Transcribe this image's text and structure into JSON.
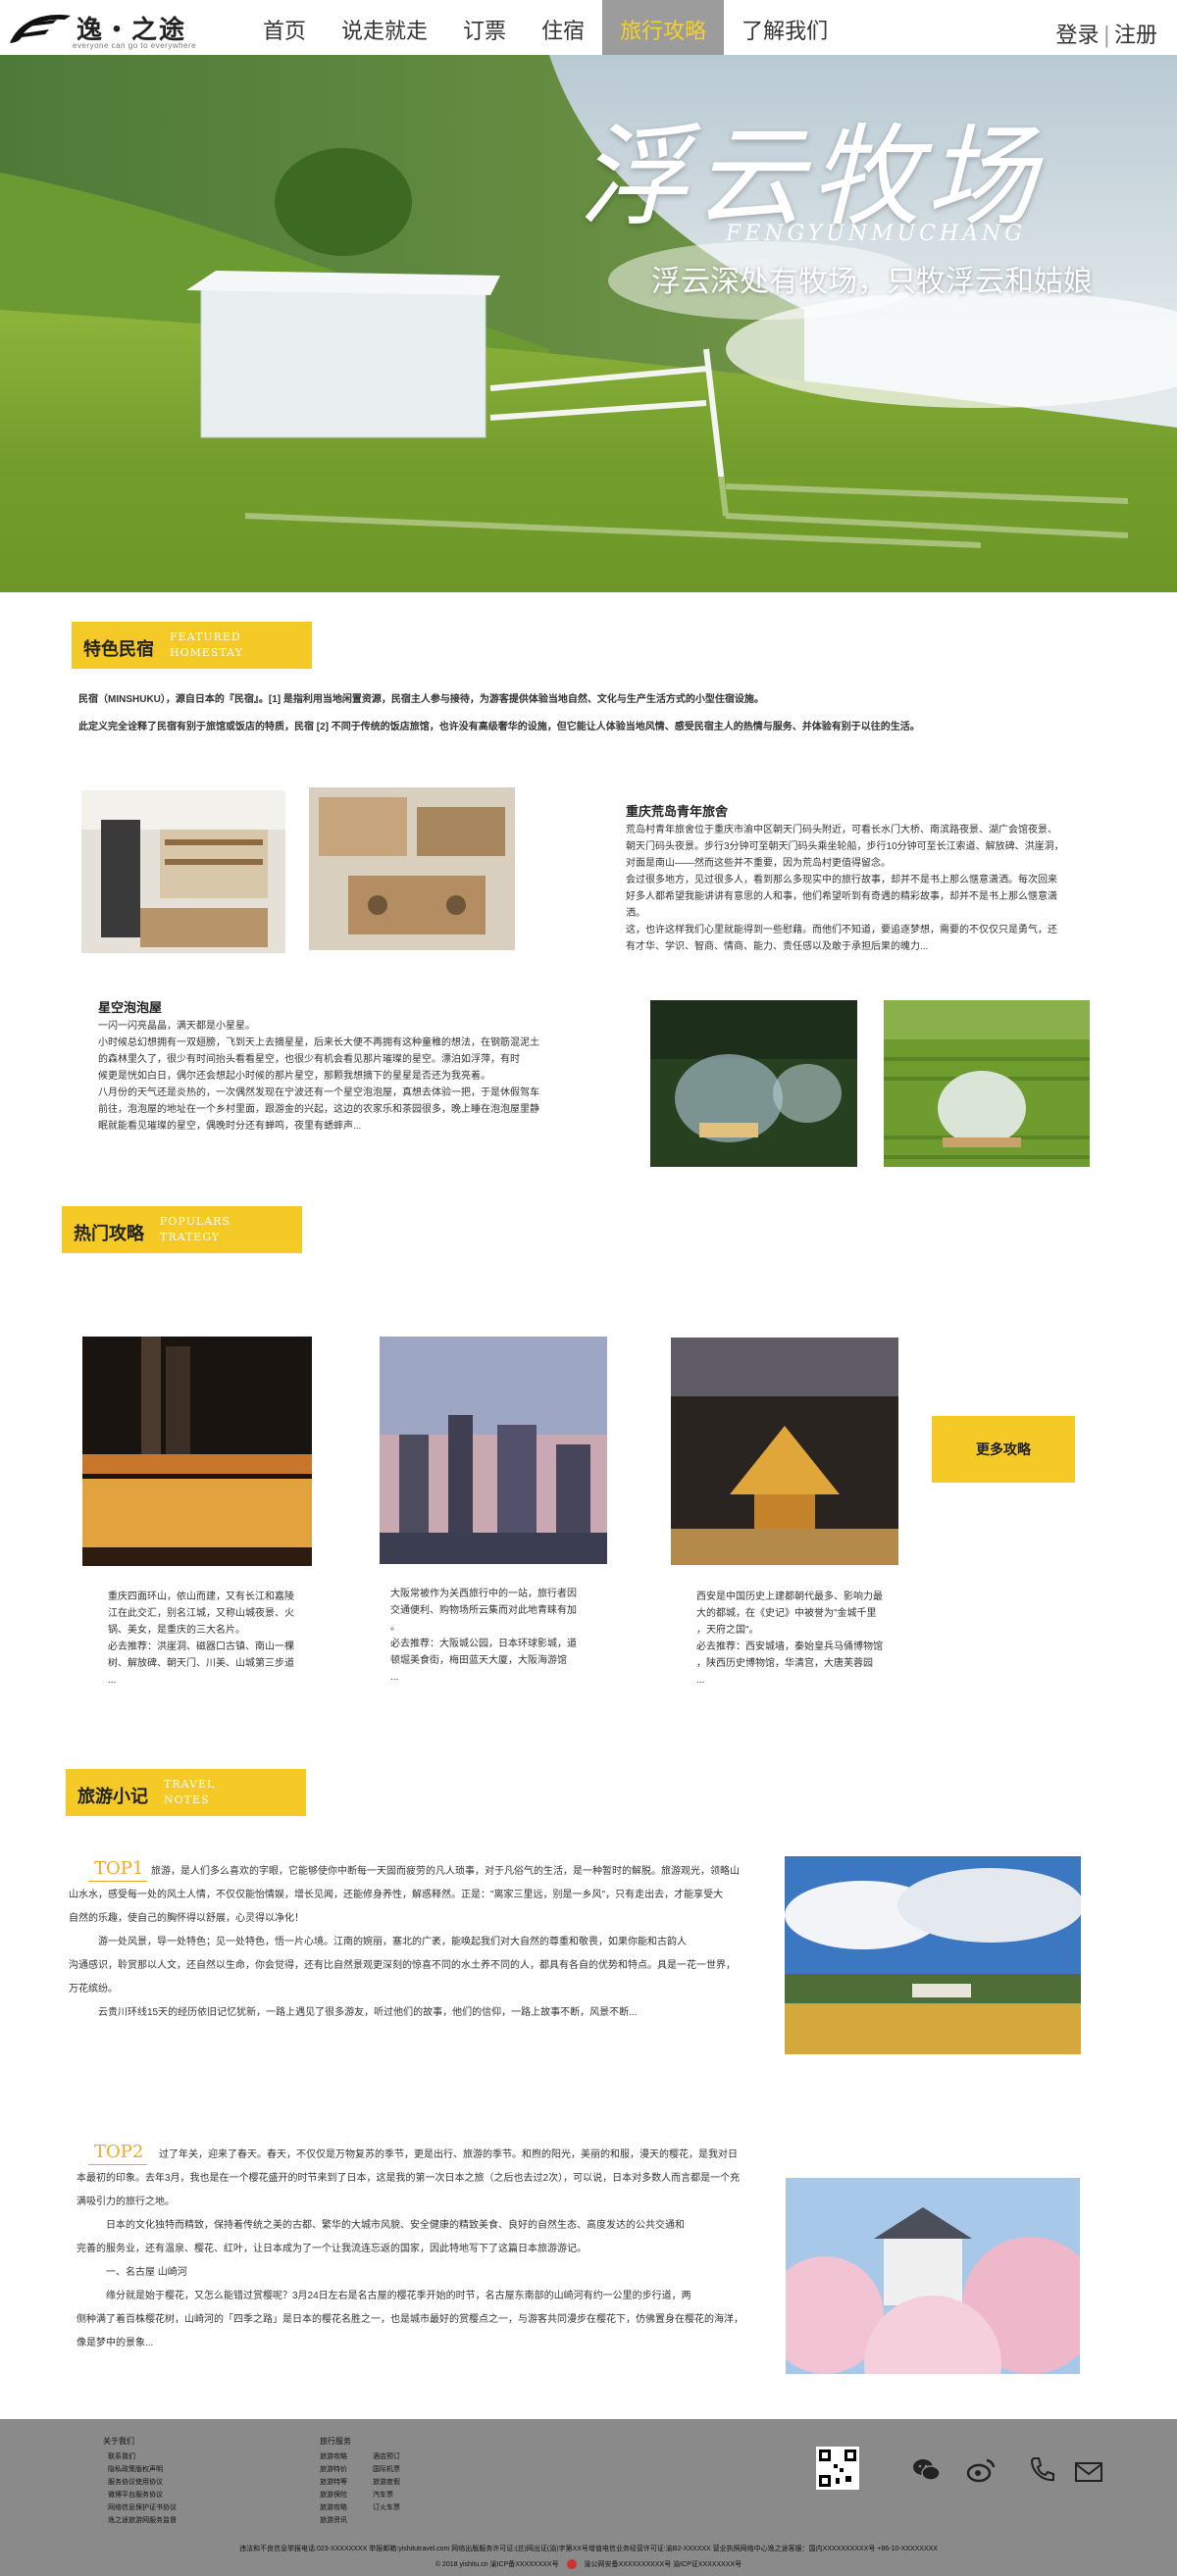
{
  "brand": {
    "name": "逸・之途",
    "slogan": "everyone can go to everywhere"
  },
  "nav": {
    "items": [
      "首页",
      "说走就走",
      "订票",
      "住宿",
      "旅行攻略",
      "了解我们"
    ],
    "active_index": 4
  },
  "auth": {
    "login": "登录",
    "register": "注册"
  },
  "hero": {
    "title": "浮云牧场",
    "subtitle_en": "FENGYUNMUCHANG",
    "tagline": "浮云深处有牧场，只牧浮云和姑娘"
  },
  "featured": {
    "heading_cn": "特色民宿",
    "heading_en_1": "FEATURED",
    "heading_en_2": "HOMESTAY",
    "intro_1": "民宿（MINSHUKU），源自日本的『民宿』。[1] 是指利用当地闲置资源，民宿主人参与接待，为游客提供体验当地自然、文化与生产生活方式的小型住宿设施。",
    "intro_2": "此定义完全诠释了民宿有别于旅馆或饭店的特质，民宿 [2] 不同于传统的饭店旅馆，也许没有高级奢华的设施，但它能让人体验当地风情、感受民宿主人的热情与服务、并体验有别于以往的生活。",
    "card1": {
      "title": "重庆荒岛青年旅舍",
      "lines": [
        "荒岛村青年旅舍位于重庆市渝中区朝天门码头附近，可看长水门大桥、南滨路夜景、湖广会馆夜景、",
        "朝天门码头夜景。步行3分钟可至朝天门码头乘坐轮船，步行10分钟可至长江索道、解放碑、洪崖洞，",
        "对面是南山——然而这些并不重要，因为荒岛村更值得留念。",
        "会过很多地方，见过很多人，看到那么多现实中的旅行故事，却并不是书上那么惬意潇洒。每次回来",
        "好多人都希望我能讲讲有意思的人和事，他们希望听到有奇遇的精彩故事，却并不是书上那么惬意潇洒。",
        "这，也许这样我们心里就能得到一些慰藉。而他们不知道，要追逐梦想，需要的不仅仅只是勇气，还",
        "有才华、学识、智商、情商、能力、责任感以及敢于承担后果的魄力..."
      ]
    },
    "card2": {
      "title": "星空泡泡屋",
      "lines": [
        "一闪一闪亮晶晶，满天都是小星星。",
        "小时候总幻想拥有一双翅膀，飞到天上去摘星星，后来长大便不再拥有这种童稚的想法，在钢筋混泥土",
        "的森林里久了，很少有时间抬头看看星空，也很少有机会看见那片璀璨的星空。漂泊如浮萍，有时",
        "候更是恍如白日，偶尔还会想起小时候的那片星空，那颗我想摘下的星星是否还为我亮着。",
        "八月份的天气还是炎热的，一次偶然发现在宁波还有一个星空泡泡屋，真想去体验一把，于是休假驾车",
        "前往，泡泡屋的地址在一个乡村里面，跟游金的兴起，这边的农家乐和茶园很多，晚上睡在泡泡屋里静",
        "眠就能看见璀璨的星空，偶晚时分还有蝉鸣，夜里有蟋蟀声..."
      ]
    }
  },
  "strategy": {
    "heading_cn": "热门攻略",
    "heading_en_1": "POPULARS",
    "heading_en_2": "TRATEGY",
    "more": "更多攻略",
    "cards": [
      {
        "lines": [
          "重庆四面环山，依山而建，又有长江和嘉陵",
          "江在此交汇，别名江城，又称山城夜景、火",
          "锅、美女，是重庆的三大名片。",
          "必去推荐：洪崖洞、磁器口古镇、南山一棵",
          "树、解放碑、朝天门、川美、山城第三步道",
          "..."
        ]
      },
      {
        "lines": [
          "大阪常被作为关西旅行中的一站，旅行者因",
          "交通便利、购物场所云集而对此地青睐有加",
          "。",
          "必去推荐：大阪城公园，日本环球影城，道",
          "顿堀美食街，梅田蓝天大厦，大阪海游馆",
          "..."
        ]
      },
      {
        "lines": [
          "西安是中国历史上建都朝代最多、影响力最",
          "大的都城，在《史记》中被誉为\"金城千里",
          "，天府之国\"。",
          "必去推荐：西安城墙，秦始皇兵马俑博物馆",
          "，陕西历史博物馆，华清宫，大唐芙蓉园",
          "..."
        ]
      }
    ]
  },
  "notes": {
    "heading_cn": "旅游小记",
    "heading_en_1": "TRAVEL",
    "heading_en_2": "NOTES",
    "top1": {
      "label": "TOP1",
      "lines": [
        "旅游，是人们多么喜欢的字眼，它能够使你中断每一天固而疲劳的凡人琐事，对于凡俗气的生活，是一种暂时的解脱。旅游观光，领略山",
        "山水水，感受每一处的风土人情，不仅仅能怡情娱，增长见闻，还能修身养性，解惑释然。正是：\"离家三里远，别是一乡风\"，只有走出去，才能享受大",
        "自然的乐趣，使自己的胸怀得以舒展，心灵得以净化！",
        "　　　游一处风景，导一处特色；见一处特色，悟一片心境。江南的婉丽，塞北的广袤，能唤起我们对大自然的尊重和敬畏，如果你能和古韵人",
        "沟通感识，聆赏那以人文，还自然以生命，你会觉得，还有比自然景观更深刻的惊喜不同的水土养不同的人，都具有各自的优势和特点。具是一花一世界，",
        "万花缤纷。",
        "　　　云贵川环线15天的经历依旧记忆犹新，一路上遇见了很多游友，听过他们的故事，他们的信仰，一路上故事不断，风景不断..."
      ]
    },
    "top2": {
      "label": "TOP2",
      "lines": [
        "过了年关，迎来了春天。春天，不仅仅是万物复苏的季节，更是出行、旅游的季节。和煦的阳光，美丽的和服，漫天的樱花，是我对日",
        "本最初的印象。去年3月，我也是在一个樱花盛开的时节来到了日本，这是我的第一次日本之旅（之后也去过2次），可以说，日本对多数人而言都是一个充",
        "满吸引力的旅行之地。",
        "　　　日本的文化独特而精致，保持着传统之美的古都、繁华的大城市风貌、安全健康的精致美食、良好的自然生态、高度发达的公共交通和",
        "完善的服务业，还有温泉、樱花、红叶，让日本成为了一个让我流连忘返的国家，因此特地写下了这篇日本旅游游记。",
        "　　　一、名古屋 山崎河",
        "　　　缘分就是始于樱花，又怎么能错过赏樱呢？3月24日左右是名古屋的樱花季开始的时节，名古屋东南部的山崎河有约一公里的步行道，两",
        "侧种满了着百株樱花树，山崎河的「四季之路」是日本的樱花名胜之一，也是城市最好的赏樱点之一，与游客共同漫步在樱花下，仿佛置身在樱花的海洋，",
        "像是梦中的景象..."
      ]
    }
  },
  "footer": {
    "col1_title": "关于我们",
    "col1_items": [
      "联系我们",
      "隐私政策版权声明",
      "服务协议使用协议",
      "微博平台服务协议",
      "网络信息保护证书协议",
      "逸之途旅游网服务监督"
    ],
    "col2_title": "旅行服务",
    "col2a_items": [
      "旅游攻略",
      "旅游特价",
      "旅游特等",
      "旅游保险",
      "旅游攻略",
      "旅游资讯"
    ],
    "col2b_items": [
      "酒店预订",
      "国际机票",
      "旅游度假",
      "汽车票",
      "订火车票"
    ],
    "line1": "违法和不良信息举报电话:023-XXXXXXXX  举报邮箱:yishitutravel.com  网络出版服务许可证:(总)网出证(渝)字第XX号增值电信业务经营许可证:渝B2-XXXXXX  营业执照网络中心逸之途客服：国内XXXXXXXXXX号 +86-10-XXXXXXXX",
    "line2_a": "© 2018 yishitu.cn 渝ICP备XXXXXXXX号",
    "line2_b": "渝公网安备XXXXXXXXXX号 渝ICP证XXXXXXXX号"
  },
  "colors": {
    "accent": "#f5c926",
    "nav_active_bg": "#9c9c9c",
    "footer_bg": "#8a8a8a",
    "top_label": "#f5a623"
  }
}
